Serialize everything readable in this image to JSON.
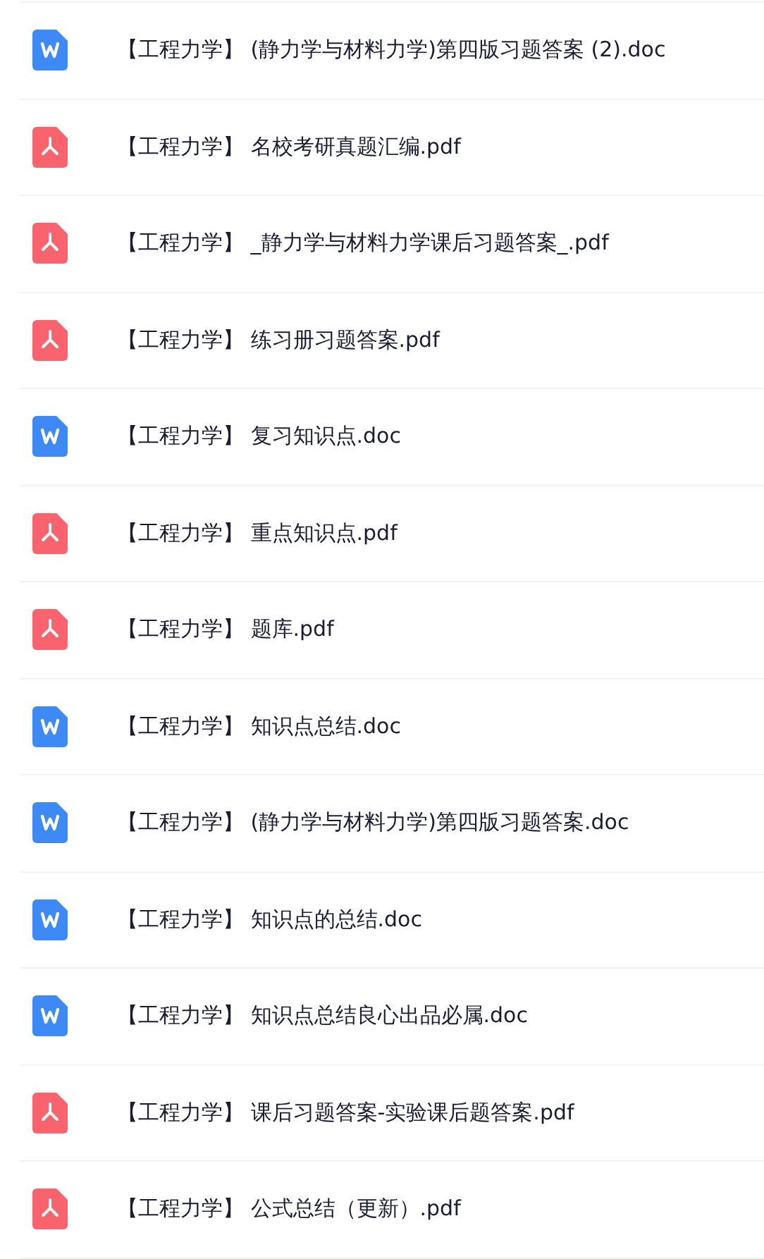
{
  "files": [
    {
      "kind": "doc",
      "name": "【工程力学】 (静力学与材料力学)第四版习题答案 (2).doc"
    },
    {
      "kind": "pdf",
      "name": "【工程力学】 名校考研真题汇编.pdf"
    },
    {
      "kind": "pdf",
      "name": "【工程力学】 _静力学与材料力学课后习题答案_.pdf"
    },
    {
      "kind": "pdf",
      "name": "【工程力学】 练习册习题答案.pdf"
    },
    {
      "kind": "doc",
      "name": "【工程力学】 复习知识点.doc"
    },
    {
      "kind": "pdf",
      "name": "【工程力学】 重点知识点.pdf"
    },
    {
      "kind": "pdf",
      "name": "【工程力学】 题库.pdf"
    },
    {
      "kind": "doc",
      "name": "【工程力学】 知识点总结.doc"
    },
    {
      "kind": "doc",
      "name": "【工程力学】 (静力学与材料力学)第四版习题答案.doc"
    },
    {
      "kind": "doc",
      "name": "【工程力学】 知识点的总结.doc"
    },
    {
      "kind": "doc",
      "name": "【工程力学】 知识点总结良心出品必属.doc"
    },
    {
      "kind": "pdf",
      "name": "【工程力学】 课后习题答案-实验课后题答案.pdf"
    },
    {
      "kind": "pdf",
      "name": "【工程力学】 公式总结（更新）.pdf"
    }
  ]
}
